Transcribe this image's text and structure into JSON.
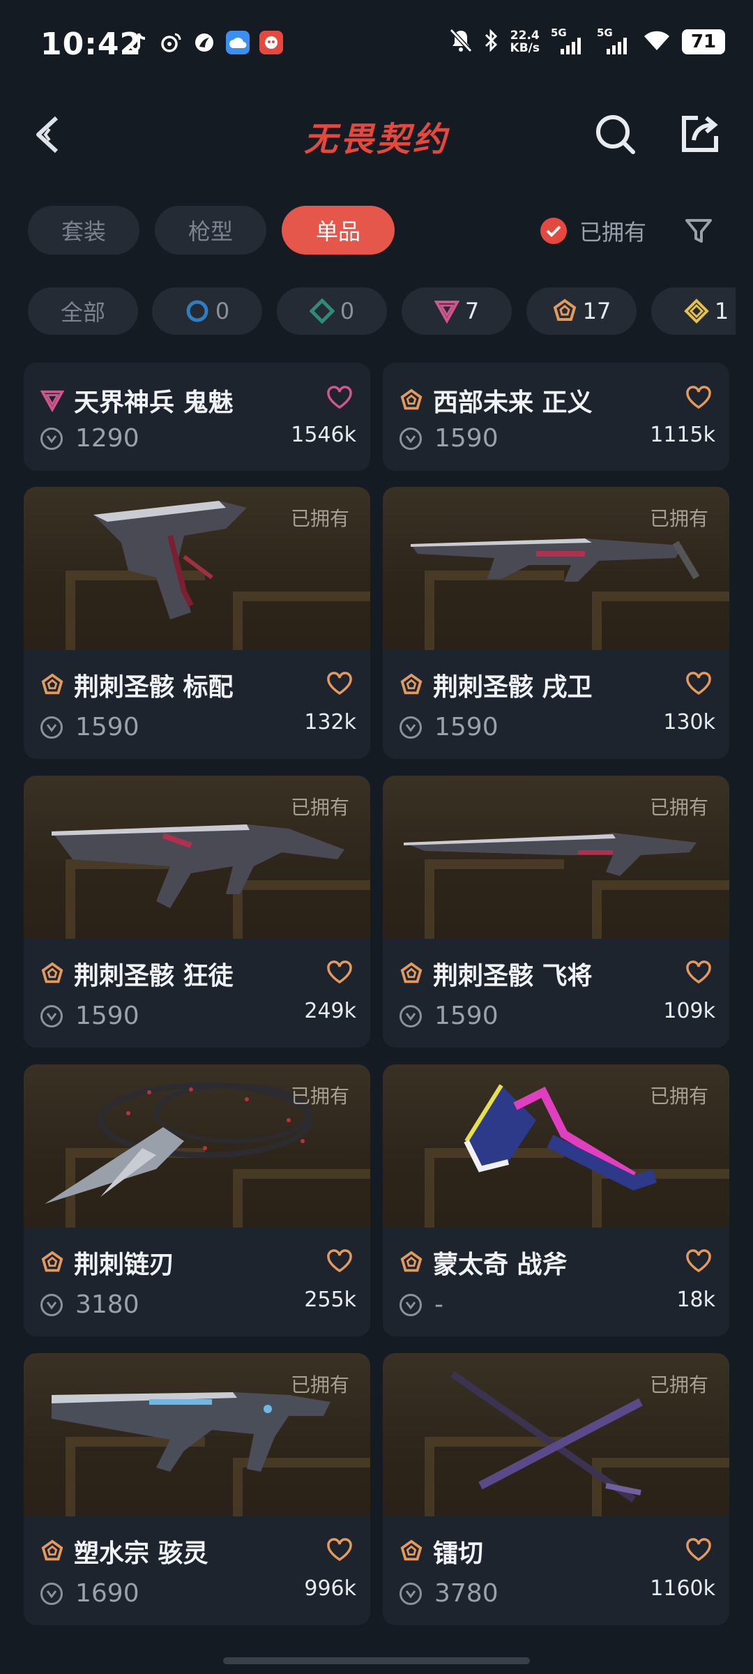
{
  "status_bar": {
    "time": "10:42",
    "net_speed_value": "22.4",
    "net_speed_unit": "KB/s",
    "sig1": "5G",
    "sig2": "5G",
    "battery": "71",
    "app_icons": [
      "tiktok-icon",
      "weibo-icon",
      "browser-icon",
      "cloud-icon",
      "pinduoduo-icon"
    ]
  },
  "header": {
    "title": "无畏契约",
    "icons": [
      "back-icon",
      "search-icon",
      "share-icon"
    ]
  },
  "tabs": [
    {
      "label": "套装"
    },
    {
      "label": "枪型"
    },
    {
      "label": "单品"
    }
  ],
  "active_tab": "单品",
  "owned_filter": {
    "label": "已拥有",
    "checked": true
  },
  "rarity_chips": [
    {
      "label": "全部"
    },
    {
      "icon": "select-rarity-icon",
      "count": "0",
      "color": "#2f7fc0"
    },
    {
      "icon": "deluxe-rarity-icon",
      "count": "0",
      "color": "#2f8a7a"
    },
    {
      "icon": "premium-rarity-icon",
      "count": "7",
      "color": "#d0568f"
    },
    {
      "icon": "exclusive-rarity-icon",
      "count": "17",
      "color": "#e39a5a"
    },
    {
      "icon": "ultra-rarity-icon",
      "count": "1",
      "color": "#e6c14a"
    }
  ],
  "owned_tag": "已拥有",
  "cards": [
    {
      "name": "天界神兵 鬼魅",
      "rarity": "premium",
      "price": "1290",
      "likes": "1546k",
      "owned": false
    },
    {
      "name": "西部未来 正义",
      "rarity": "exclusive",
      "price": "1590",
      "likes": "1115k",
      "owned": false
    },
    {
      "name": "荆刺圣骸 标配",
      "rarity": "exclusive",
      "price": "1590",
      "likes": "132k",
      "owned": true
    },
    {
      "name": "荆刺圣骸 戌卫",
      "rarity": "exclusive",
      "price": "1590",
      "likes": "130k",
      "owned": true
    },
    {
      "name": "荆刺圣骸 狂徒",
      "rarity": "exclusive",
      "price": "1590",
      "likes": "249k",
      "owned": true
    },
    {
      "name": "荆刺圣骸 飞将",
      "rarity": "exclusive",
      "price": "1590",
      "likes": "109k",
      "owned": true
    },
    {
      "name": "荆刺链刃",
      "rarity": "exclusive",
      "price": "3180",
      "likes": "255k",
      "owned": true
    },
    {
      "name": "蒙太奇 战斧",
      "rarity": "exclusive",
      "price": "-",
      "likes": "18k",
      "owned": true
    },
    {
      "name": "塑水宗 骇灵",
      "rarity": "exclusive",
      "price": "1690",
      "likes": "996k",
      "owned": true
    },
    {
      "name": "镭切",
      "rarity": "exclusive",
      "price": "3780",
      "likes": "1160k",
      "owned": true
    }
  ],
  "colors": {
    "accent": "#e5564b",
    "title": "#e5483f",
    "premium": "#d0568f",
    "exclusive": "#e39a5a",
    "heart": "#e39a5a"
  }
}
